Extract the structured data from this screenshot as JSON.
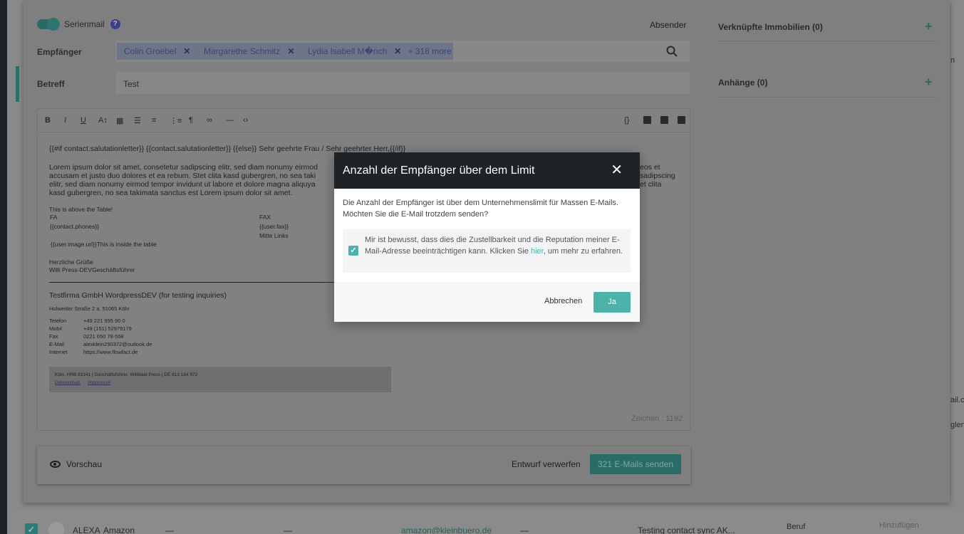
{
  "composer": {
    "serienmail_label": "Serienmail",
    "help_glyph": "?",
    "absender_label": "Absender",
    "empfaenger_label": "Empfänger",
    "recipients": [
      "Colin Groebel",
      "Margarethe Schmitz",
      "Lydia Isabell M�nch"
    ],
    "more_recipients": "+ 318 more",
    "betreff_label": "Betreff",
    "betreff_value": "Test",
    "editor_lines": {
      "line1": "{{#if contact.salutationletter}} {{contact.salutationletter}} {{else}} Sehr geehrte Frau / Sehr geehrter Herr,{{/if}}",
      "lorem1": "Lorem ipsum dolor sit amet, consetetur sadipscing elitr, sed diam nonumy eirmod",
      "lorem1_end": "eos et",
      "lorem2": "accusam et justo duo dolores et ea rebum. Stet clita kasd gubergren, no sea taki",
      "lorem2_end": "sadipscing",
      "lorem3": "elitr, sed diam nonumy eirmod tempor invidunt ut labore et dolore magna aliquya",
      "lorem3_end": "et clita",
      "lorem4": "kasd gubergren, no sea takimata sanctus est Lorem ipsum dolor sit amet.",
      "above_table": "This is above the Table!",
      "fa": "FA",
      "fax": "FAX",
      "phones": "{{contact.phones}}",
      "user_fax": "{{user.fax}}",
      "mitte_links": "Mitte Links",
      "inside_table": "{{user.image.url}}This is inside the table",
      "gruesse": "Herzliche Grüße",
      "signature": "Willi Press-DEVGeschäftsführer",
      "company": "Testfirma GmbH WordpressDEV (for testing inquiries)",
      "address": "Holweider Straße 2 a, 51065 Köln",
      "telefon_label": "Telefon",
      "telefon": "+49 221 995 90 0",
      "mobil_label": "Mobil",
      "mobil": "+49 (151) 52979179",
      "fax_label": "Fax",
      "fax_value": "0221 650 78-558",
      "email_label": "E-Mail",
      "email": "alexklein290372@outlook.de",
      "internet_label": "Internet",
      "internet": "https://www.flowfact.de",
      "footer_line": "Köln, HRB 83141 | Geschäftsführer: Willibald Press | DE 813 184 972",
      "datenschutz": "Datenschutz",
      "impressum": "Impressum"
    },
    "zeichen": "Zeichen : 1192",
    "vorschau": "Vorschau",
    "entwurf_verwerfen": "Entwurf verwerfen",
    "send_button": "321 E-Mails senden"
  },
  "right_column": {
    "immobilien": "Verknüpfte Immobilien (0)",
    "anhaenge": "Anhänge (0)",
    "plus": "+"
  },
  "background": {
    "row_name": "ALEXA",
    "row_company": "Amazon",
    "row_dash": "—",
    "row_email": "amazon@kleinbuero.de",
    "row_info": "Testing contact sync  AK...",
    "beruf": "Beruf",
    "hinzufuegen": "Hinzufügen",
    "edge_n": "n",
    "edge_ail": "ail.co",
    "edge_glen": "glen"
  },
  "modal": {
    "title": "Anzahl der Empfänger über dem Limit",
    "close_glyph": "✕",
    "body": "Die Anzahl der Empfänger ist über dem Unternehmenslimit für Massen E-Mails. Möchten Sie die E-Mail trotzdem senden?",
    "checkbox_text_before": "Mir ist bewusst, dass dies die Zustellbarkeit und die Reputation meiner E-Mail-Adresse beeinträchtigen kann. Klicken Sie ",
    "checkbox_link": "hier",
    "checkbox_text_after": ", um mehr zu erfahren.",
    "checkbox_checked": true,
    "cancel_label": "Abbrechen",
    "confirm_label": "Ja"
  },
  "colors": {
    "accent": "#4db3a9",
    "modal_header": "#1f2326",
    "chip": "#6f7589"
  }
}
